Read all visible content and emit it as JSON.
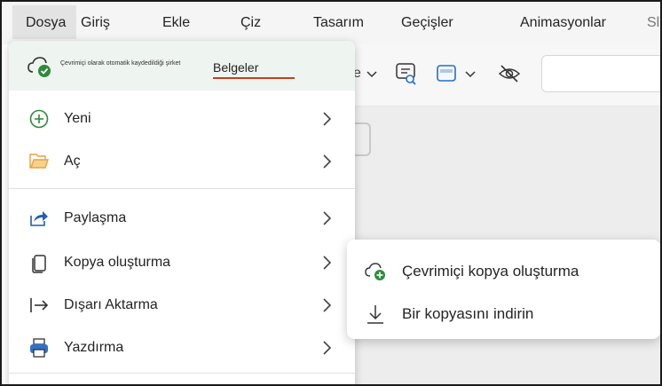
{
  "ribbon": {
    "tabs": [
      {
        "label": "Dosya"
      },
      {
        "label": "Giriş"
      },
      {
        "label": "Ekle"
      },
      {
        "label": "Çiz"
      },
      {
        "label": "Tasarım"
      },
      {
        "label": "Geçişler"
      },
      {
        "label": "Animasyonlar"
      },
      {
        "label": "Sl"
      }
    ],
    "toolbar": {
      "partial_label": "e"
    }
  },
  "file_menu": {
    "header": {
      "save_status": "Çevrimiçi olarak otomatik kaydedildiği şirket",
      "location_link": "Belgeler"
    },
    "items": [
      {
        "label": "Yeni",
        "icon": "plus-circle-icon"
      },
      {
        "label": "Aç",
        "icon": "folder-open-icon"
      },
      {
        "label": "Paylaşma",
        "icon": "share-icon"
      },
      {
        "label": "Kopya oluşturma",
        "icon": "copy-icon"
      },
      {
        "label": "Dışarı Aktarma",
        "icon": "export-icon"
      },
      {
        "label": "Yazdırma",
        "icon": "printer-icon"
      }
    ]
  },
  "copy_submenu": {
    "items": [
      {
        "label": "Çevrimiçi kopya oluşturma",
        "icon": "cloud-add-icon"
      },
      {
        "label": "Bir kopyasını indirin",
        "icon": "download-icon"
      }
    ]
  },
  "colors": {
    "accent_green": "#2f8a3c",
    "link_underline": "#c4401c",
    "folder_orange": "#e8a33b",
    "share_blue": "#1f5fae",
    "printer_blue": "#2f72c8"
  }
}
